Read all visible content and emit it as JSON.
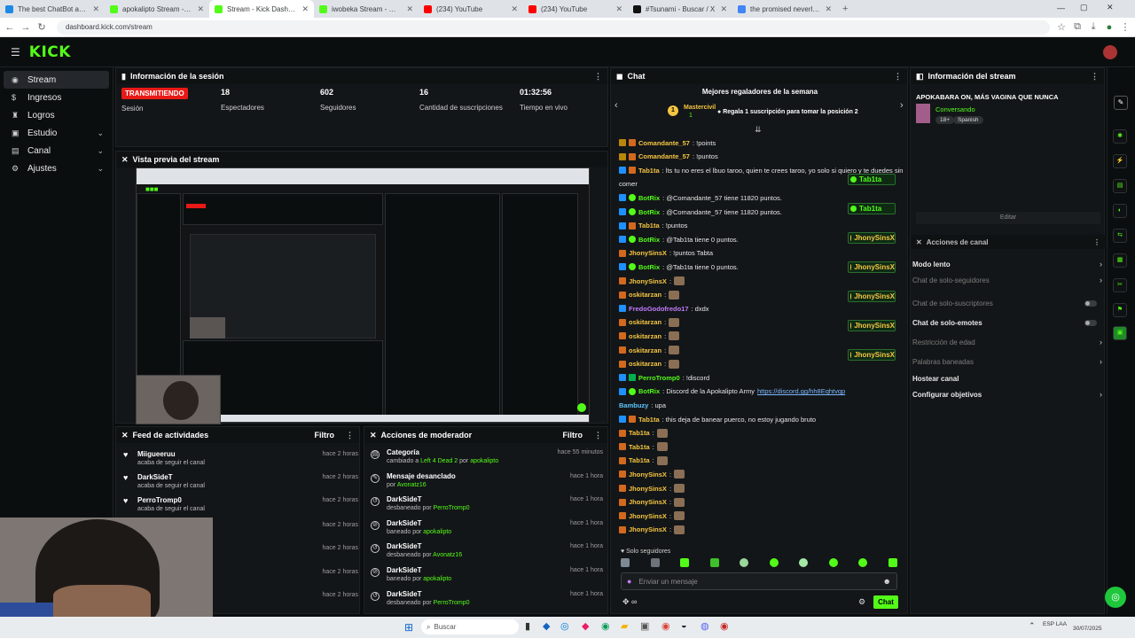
{
  "browser": {
    "tabs": [
      {
        "title": "The best ChatBot and Widgets",
        "color": "#1e88e5"
      },
      {
        "title": "apokalipto Stream - Watch Live",
        "color": "#53fc18"
      },
      {
        "title": "Stream - Kick Dashboard",
        "color": "#53fc18"
      },
      {
        "title": "iwobeka Stream - Watch Live",
        "color": "#53fc18"
      },
      {
        "title": "(234) YouTube",
        "color": "#ff0000"
      },
      {
        "title": "(234) YouTube",
        "color": "#ff0000"
      },
      {
        "title": "#Tsunami - Buscar / X",
        "color": "#111111"
      },
      {
        "title": "the promised neverland - Busc",
        "color": "#4285f4"
      }
    ],
    "url": "dashboard.kick.com/stream"
  },
  "logo": "KICK",
  "sidebar": {
    "items": [
      {
        "label": "Stream",
        "icon": "radio-icon",
        "active": true
      },
      {
        "label": "Ingresos",
        "icon": "money-icon"
      },
      {
        "label": "Logros",
        "icon": "trophy-icon"
      },
      {
        "label": "Estudio",
        "icon": "studio-icon",
        "chevron": true
      },
      {
        "label": "Canal",
        "icon": "channel-icon",
        "chevron": true
      },
      {
        "label": "Ajustes",
        "icon": "gear-icon",
        "chevron": true
      }
    ]
  },
  "session": {
    "title": "Información de la sesión",
    "live_label": "TRANSMITIENDO",
    "session_label": "Sesión",
    "stats": [
      {
        "value": "18",
        "label": "Espectadores"
      },
      {
        "value": "602",
        "label": "Seguidores"
      },
      {
        "value": "16",
        "label": "Cantidad de suscripciones"
      },
      {
        "value": "01:32:56",
        "label": "Tiempo en vivo"
      }
    ]
  },
  "preview": {
    "title": "Vista previa del stream"
  },
  "feed": {
    "title": "Feed de actividades",
    "filter": "Filtro",
    "items": [
      {
        "name": "Miigueeruu",
        "action": "acaba de seguir el canal",
        "time": "hace 2 horas"
      },
      {
        "name": "DarkSideT",
        "action": "acaba de seguir el canal",
        "time": "hace 2 horas"
      },
      {
        "name": "PerroTromp0",
        "action": "acaba de seguir el canal",
        "time": "hace 2 horas"
      },
      {
        "time": "hace 2 horas"
      },
      {
        "time": "hace 2 horas"
      },
      {
        "time": "hace 2 horas"
      },
      {
        "time": "hace 2 horas"
      }
    ]
  },
  "modactions": {
    "title": "Acciones de moderador",
    "filter": "Filtro",
    "items": [
      {
        "title": "Categoría",
        "pre": "cambiado a ",
        "hl": "Left 4 Dead 2",
        "mid": " por ",
        "by": "apokalipto",
        "time": "hace 55 minutos"
      },
      {
        "title": "Mensaje desanclado",
        "pre": "por ",
        "hl": "",
        "mid": "",
        "by": "Avonatz16",
        "time": "hace 1 hora"
      },
      {
        "title": "DarkSideT",
        "pre": "desbaneado por ",
        "hl": "",
        "mid": "",
        "by": "PerroTromp0",
        "time": "hace 1 hora"
      },
      {
        "title": "DarkSideT",
        "pre": "baneado por ",
        "hl": "",
        "mid": "",
        "by": "apokalipto",
        "time": "hace 1 hora"
      },
      {
        "title": "DarkSideT",
        "pre": "desbaneado por ",
        "hl": "",
        "mid": "",
        "by": "Avonatz16",
        "time": "hace 1 hora"
      },
      {
        "title": "DarkSideT",
        "pre": "baneado por ",
        "hl": "",
        "mid": "",
        "by": "apokalipto",
        "time": "hace 1 hora"
      },
      {
        "title": "DarkSideT",
        "pre": "desbaneado por ",
        "hl": "",
        "mid": "",
        "by": "PerroTromp0",
        "time": "hace 1 hora"
      }
    ]
  },
  "chat": {
    "title": "Chat",
    "top_title": "Mejores regaladores de la semana",
    "top_rank": "1",
    "top_user": "Mastercivil",
    "top_count": "1",
    "top_cta": "Regala 1 suscripción para tomar la posición 2",
    "messages": [
      {
        "user": "Comandante_57",
        "color": "y",
        "text": ": !points",
        "badges": [
          "gift",
          "sub"
        ]
      },
      {
        "user": "Comandante_57",
        "color": "y",
        "text": ": !puntos",
        "badges": [
          "gift",
          "sub"
        ]
      },
      {
        "user": "Tab1ta",
        "color": "y",
        "text": ": lts tu no eres el lbuo taroo, quien te crees taroo, yo solo si quiero y te duedes sin",
        "badges": [
          "bot",
          "sub"
        ]
      },
      {
        "user": "",
        "color": "",
        "text": "comer",
        "badges": []
      },
      {
        "user": "BotRix",
        "color": "g",
        "text": ": @Comandante_57 tiene 11820 puntos.",
        "badges": [
          "bot",
          "ver"
        ]
      },
      {
        "user": "BotRix",
        "color": "g",
        "text": ": @Comandante_57 tiene 11820 puntos.",
        "badges": [
          "bot",
          "ver"
        ]
      },
      {
        "user": "Tab1ta",
        "color": "y",
        "text": ": !puntos",
        "badges": [
          "bot",
          "sub"
        ]
      },
      {
        "user": "BotRix",
        "color": "g",
        "text": ": @Tab1ta tiene 0 puntos.",
        "badges": [
          "bot",
          "ver"
        ]
      },
      {
        "user": "JhonySinsX",
        "color": "y",
        "text": ": !puntos Tabta",
        "badges": [
          "sub"
        ]
      },
      {
        "user": "BotRix",
        "color": "g",
        "text": ": @Tab1ta tiene 0 puntos.",
        "badges": [
          "bot",
          "ver"
        ]
      },
      {
        "user": "JhonySinsX",
        "color": "y",
        "text": ":",
        "badges": [
          "sub"
        ],
        "emote": true
      },
      {
        "user": "oskitarzan",
        "color": "y",
        "text": ":",
        "badges": [
          "sub"
        ],
        "emote": true
      },
      {
        "user": "FredoGodofredo17",
        "color": "p",
        "text": ": dxdx",
        "badges": [
          "bot"
        ]
      },
      {
        "user": "oskitarzan",
        "color": "y",
        "text": ":",
        "badges": [
          "sub"
        ],
        "emote": true
      },
      {
        "user": "oskitarzan",
        "color": "y",
        "text": ":",
        "badges": [
          "sub"
        ],
        "emote": true
      },
      {
        "user": "oskitarzan",
        "color": "y",
        "text": ":",
        "badges": [
          "sub"
        ],
        "emote": true
      },
      {
        "user": "oskitarzan",
        "color": "y",
        "text": ":",
        "badges": [
          "sub"
        ],
        "emote": true
      },
      {
        "user": "PerroTromp0",
        "color": "g",
        "text": ": !discord",
        "badges": [
          "bot",
          "mod"
        ]
      },
      {
        "user": "BotRix",
        "color": "g",
        "text": ": Discord de la Apokalipto Army ",
        "link": "https://discord.gg/hh8Eqhtvqp",
        "badges": [
          "bot",
          "ver"
        ]
      },
      {
        "user": "Bambuzy",
        "color": "b",
        "text": ": upa",
        "badges": []
      },
      {
        "user": "Tab1ta",
        "color": "y",
        "text": ": this deja de banear puerco, no estoy jugando bruto",
        "badges": [
          "bot",
          "sub"
        ]
      },
      {
        "user": "Tab1ta",
        "color": "y",
        "text": ":",
        "badges": [
          "sub"
        ],
        "emote": true
      },
      {
        "user": "Tab1ta",
        "color": "y",
        "text": ":",
        "badges": [
          "sub"
        ],
        "emote": true
      },
      {
        "user": "Tab1ta",
        "color": "y",
        "text": ":",
        "badges": [
          "sub"
        ],
        "emote": true
      },
      {
        "user": "JhonySinsX",
        "color": "y",
        "text": ":",
        "badges": [
          "sub"
        ],
        "emote": true
      },
      {
        "user": "JhonySinsX",
        "color": "y",
        "text": ":",
        "badges": [
          "sub"
        ],
        "emote": true
      },
      {
        "user": "JhonySinsX",
        "color": "y",
        "text": ":",
        "badges": [
          "sub"
        ],
        "emote": true
      },
      {
        "user": "JhonySinsX",
        "color": "y",
        "text": ":",
        "badges": [
          "sub"
        ],
        "emote": true
      },
      {
        "user": "JhonySinsX",
        "color": "y",
        "text": ":",
        "badges": [
          "sub"
        ],
        "emote": true
      }
    ],
    "gift_pills": [
      {
        "user": "Tab1ta",
        "green": true
      },
      {
        "user": "Tab1ta",
        "green": true
      },
      {
        "user": "JhonySinsX",
        "green": false
      },
      {
        "user": "JhonySinsX",
        "green": false
      },
      {
        "user": "JhonySinsX",
        "green": false
      },
      {
        "user": "JhonySinsX",
        "green": false
      },
      {
        "user": "JhonySinsX",
        "green": false
      }
    ],
    "followers_only": "Solo seguidores",
    "input_placeholder": "Enviar un mensaje",
    "send_label": "Chat"
  },
  "streaminfo": {
    "title": "Información del stream",
    "stream_title": "APOKABARA ON, MÁS VAGINA QUE NUNCA",
    "category": "Conversando",
    "tags": [
      "18+",
      "Spanish"
    ],
    "edit_label": "Editar"
  },
  "channelactions": {
    "title": "Acciones de canal",
    "options": [
      {
        "label": "Modo lento",
        "kind": "chev",
        "dim": false
      },
      {
        "label": "Chat de solo-seguidores",
        "kind": "chev",
        "dim": true
      },
      {
        "label": "Chat de solo-suscriptores",
        "kind": "toggle",
        "dim": true
      },
      {
        "label": "Chat de solo-emotes",
        "kind": "toggle",
        "dim": false
      },
      {
        "label": "Restricción de edad",
        "kind": "chev",
        "dim": true
      },
      {
        "label": "Palabras baneadas",
        "kind": "chev",
        "dim": true
      },
      {
        "label": "Hostear canal",
        "kind": "none",
        "dim": false
      },
      {
        "label": "Configurar objetivos",
        "kind": "chev",
        "dim": false
      }
    ]
  },
  "taskbar": {
    "search": "Buscar",
    "lang": "ESP LAA",
    "date": "30/07/2025"
  },
  "colors": {
    "accent": "#53fc18",
    "live": "#e91916",
    "bg": "#0b0e0f",
    "panel": "#131618"
  }
}
